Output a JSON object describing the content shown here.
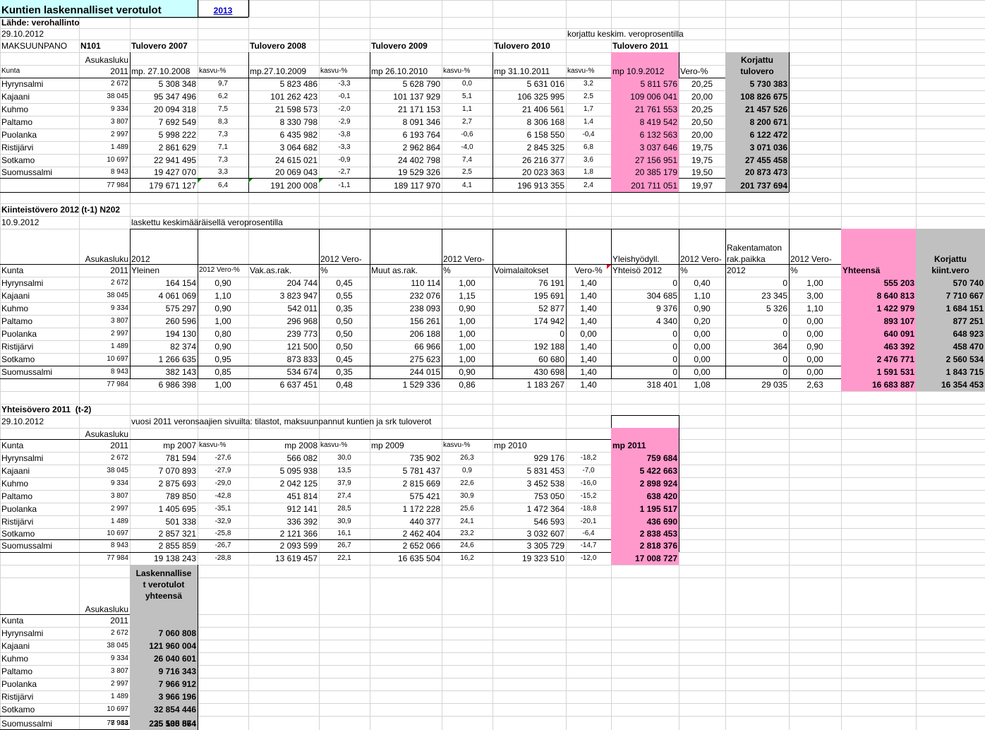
{
  "colors": {
    "pink": "#ff99cc",
    "gray": "#c0c0c0",
    "cyan": "#ccffff",
    "grid": "#d4d4d4",
    "link": "#0000cc"
  },
  "title": "Kuntien laskennalliset verotulot",
  "year_link": "2013",
  "source": "Lähde: verohallinto",
  "date1": "29.10.2012",
  "note1": "korjattu keskim. veroprosentilla",
  "maksuunpano": "MAKSUUNPANO",
  "n101": "N101",
  "income": {
    "year_heads": [
      "Tulovero 2007",
      "Tulovero 2008",
      "Tulovero 2009",
      "Tulovero 2010",
      "Tulovero 2011"
    ],
    "hdr": {
      "kunta": "Kunta",
      "asukas": "Asukasluku\n2011",
      "mp1": "mp. 27.10.2008",
      "k1": "kasvu-%",
      "mp2": "mp.27.10.2009",
      "k2": "kasvu-%",
      "mp3": "mp 26.10.2010",
      "k3": "kasvu-%",
      "mp4": "mp 31.10.2011",
      "k4": "kasvu-%",
      "mp5": "mp 10.9.2012",
      "vero": "Vero-%",
      "korj": "Korjattu\ntulovero"
    },
    "rows": [
      [
        "Hyrynsalmi",
        "2 672",
        "5 308 348",
        "9,7",
        "5 823 486",
        "-3,3",
        "5 628 790",
        "0,0",
        "5 631 016",
        "3,2",
        "5 811 576",
        "20,25",
        "5 730 383"
      ],
      [
        "Kajaani",
        "38 045",
        "95 347 496",
        "6,2",
        "101 262 423",
        "-0,1",
        "101 137 929",
        "5,1",
        "106 325 995",
        "2,5",
        "109 006 041",
        "20,00",
        "108 826 675"
      ],
      [
        "Kuhmo",
        "9 334",
        "20 094 318",
        "7,5",
        "21 598 573",
        "-2,0",
        "21 171 153",
        "1,1",
        "21 406 561",
        "1,7",
        "21 761 553",
        "20,25",
        "21 457 526"
      ],
      [
        "Paltamo",
        "3 807",
        "7 692 549",
        "8,3",
        "8 330 798",
        "-2,9",
        "8 091 346",
        "2,7",
        "8 306 168",
        "1,4",
        "8 419 542",
        "20,50",
        "8 200 671"
      ],
      [
        "Puolanka",
        "2 997",
        "5 998 222",
        "7,3",
        "6 435 982",
        "-3,8",
        "6 193 764",
        "-0,6",
        "6 158 550",
        "-0,4",
        "6 132 563",
        "20,00",
        "6 122 472"
      ],
      [
        "Ristijärvi",
        "1 489",
        "2 861 629",
        "7,1",
        "3 064 682",
        "-3,3",
        "2 962 864",
        "-4,0",
        "2 845 325",
        "6,8",
        "3 037 646",
        "19,75",
        "3 071 036"
      ],
      [
        "Sotkamo",
        "10 697",
        "22 941 495",
        "7,3",
        "24 615 021",
        "-0,9",
        "24 402 798",
        "7,4",
        "26 216 377",
        "3,6",
        "27 156 951",
        "19,75",
        "27 455 458"
      ],
      [
        "Suomussalmi",
        "8 943",
        "19 427 070",
        "3,3",
        "20 069 043",
        "-2,7",
        "19 529 326",
        "2,5",
        "20 023 363",
        "1,8",
        "20 385 179",
        "19,50",
        "20 873 473"
      ]
    ],
    "total": [
      "",
      "77 984",
      "179 671 127",
      "6,4",
      "191 200 008",
      "-1,1",
      "189 117 970",
      "4,1",
      "196 913 355",
      "2,4",
      "201 711 051",
      "19,97",
      "201 737 694"
    ]
  },
  "property": {
    "title": "Kiinteistövero 2012 (t-1) N202",
    "date": "10.9.2012",
    "note": "laskettu keskimääräisellä veroprosentilla",
    "hdr": {
      "kunta": "Kunta",
      "asukas": "Asukasluku\n2011",
      "yleinen": "2012\nYleinen",
      "v1": "2012 Vero-%",
      "vakas": "Vak.as.rak.",
      "v2": "2012 Vero-\n%",
      "muut": "Muut as.rak.",
      "v3": "2012 Vero-\n%",
      "voima": "Voimalaitokset",
      "v4": "Vero-%",
      "yleis": "Yleishyödyll.\nYhteisö 2012",
      "v5": "2012 Vero-\n%",
      "rak": "Rakentamaton\nrak.paikka\n2012",
      "v6": "2012 Vero-\n%",
      "yht": "Yhteensä",
      "korj": "Korjattu\nkiint.vero"
    },
    "rows": [
      [
        "Hyrynsalmi",
        "2 672",
        "164 154",
        "0,90",
        "204 744",
        "0,45",
        "110 114",
        "1,00",
        "76 191",
        "1,40",
        "0",
        "0,40",
        "0",
        "1,00",
        "555 203",
        "570 740"
      ],
      [
        "Kajaani",
        "38 045",
        "4 061 069",
        "1,10",
        "3 823 947",
        "0,55",
        "232 076",
        "1,15",
        "195 691",
        "1,40",
        "304 685",
        "1,10",
        "23 345",
        "3,00",
        "8 640 813",
        "7 710 667"
      ],
      [
        "Kuhmo",
        "9 334",
        "575 297",
        "0,90",
        "542 011",
        "0,35",
        "238 093",
        "0,90",
        "52 877",
        "1,40",
        "9 376",
        "0,90",
        "5 326",
        "1,10",
        "1 422 979",
        "1 684 151"
      ],
      [
        "Paltamo",
        "3 807",
        "260 596",
        "1,00",
        "296 968",
        "0,50",
        "156 261",
        "1,00",
        "174 942",
        "1,40",
        "4 340",
        "0,20",
        "0",
        "0,00",
        "893 107",
        "877 251"
      ],
      [
        "Puolanka",
        "2 997",
        "194 130",
        "0,80",
        "239 773",
        "0,50",
        "206 188",
        "1,00",
        "0",
        "0,00",
        "0",
        "0,00",
        "0",
        "0,00",
        "640 091",
        "648 923"
      ],
      [
        "Ristijärvi",
        "1 489",
        "82 374",
        "0,90",
        "121 500",
        "0,50",
        "66 966",
        "1,00",
        "192 188",
        "1,40",
        "0",
        "0,00",
        "364",
        "0,90",
        "463 392",
        "458 470"
      ],
      [
        "Sotkamo",
        "10 697",
        "1 266 635",
        "0,95",
        "873 833",
        "0,45",
        "275 623",
        "1,00",
        "60 680",
        "1,40",
        "0",
        "0,00",
        "0",
        "0,00",
        "2 476 771",
        "2 560 534"
      ],
      [
        "Suomussalmi",
        "8 943",
        "382 143",
        "0,85",
        "534 674",
        "0,35",
        "244 015",
        "0,90",
        "430 698",
        "1,40",
        "0",
        "0,00",
        "0",
        "0,00",
        "1 591 531",
        "1 843 715"
      ]
    ],
    "total": [
      "",
      "77 984",
      "6 986 398",
      "1,00",
      "6 637 451",
      "0,48",
      "1 529 336",
      "0,86",
      "1 183 267",
      "1,40",
      "318 401",
      "1,08",
      "29 035",
      "2,63",
      "16 683 887",
      "16 354 453"
    ]
  },
  "corporate": {
    "title": "Yhteisövero 2011  (t-2)",
    "date": "29.10.2012",
    "note": "vuosi 2011 veronsaajien sivuilta: tilastot, maksuunpannut kuntien ja srk tuloverot",
    "hdr": {
      "kunta": "Kunta",
      "asukas": "Asukasluku\n2011",
      "mp1": "mp 2007",
      "k1": "kasvu-%",
      "mp2": "mp 2008",
      "k2": "kasvu-%",
      "mp3": "mp 2009",
      "k3": "kasvu-%",
      "mp4": "mp 2010",
      "mp5": "mp 2011"
    },
    "rows": [
      [
        "Hyrynsalmi",
        "2 672",
        "781 594",
        "-27,6",
        "566 082",
        "30,0",
        "735 902",
        "26,3",
        "929 176",
        "-18,2",
        "759 684"
      ],
      [
        "Kajaani",
        "38 045",
        "7 070 893",
        "-27,9",
        "5 095 938",
        "13,5",
        "5 781 437",
        "0,9",
        "5 831 453",
        "-7,0",
        "5 422 663"
      ],
      [
        "Kuhmo",
        "9 334",
        "2 875 693",
        "-29,0",
        "2 042 125",
        "37,9",
        "2 815 669",
        "22,6",
        "3 452 538",
        "-16,0",
        "2 898 924"
      ],
      [
        "Paltamo",
        "3 807",
        "789 850",
        "-42,8",
        "451 814",
        "27,4",
        "575 421",
        "30,9",
        "753 050",
        "-15,2",
        "638 420"
      ],
      [
        "Puolanka",
        "2 997",
        "1 405 695",
        "-35,1",
        "912 141",
        "28,5",
        "1 172 228",
        "25,6",
        "1 472 364",
        "-18,8",
        "1 195 517"
      ],
      [
        "Ristijärvi",
        "1 489",
        "501 338",
        "-32,9",
        "336 392",
        "30,9",
        "440 377",
        "24,1",
        "546 593",
        "-20,1",
        "436 690"
      ],
      [
        "Sotkamo",
        "10 697",
        "2 857 321",
        "-25,8",
        "2 121 366",
        "16,1",
        "2 462 404",
        "23,2",
        "3 032 607",
        "-6,4",
        "2 838 453"
      ],
      [
        "Suomussalmi",
        "8 943",
        "2 855 859",
        "-26,7",
        "2 093 599",
        "26,7",
        "2 652 066",
        "24,6",
        "3 305 729",
        "-14,7",
        "2 818 376"
      ]
    ],
    "total": [
      "",
      "77 984",
      "19 138 243",
      "-28,8",
      "13 619 457",
      "22,1",
      "16 635 504",
      "16,2",
      "19 323 510",
      "-12,0",
      "17 008 727"
    ]
  },
  "summary": {
    "hdr": {
      "kunta": "Kunta",
      "asukas": "Asukasluku\n2011",
      "lask": "Laskennallise\nt verotulot\nyhteensä"
    },
    "rows": [
      [
        "Hyrynsalmi",
        "2 672",
        "7 060 808"
      ],
      [
        "Kajaani",
        "38 045",
        "121 960 004"
      ],
      [
        "Kuhmo",
        "9 334",
        "26 040 601"
      ],
      [
        "Paltamo",
        "3 807",
        "9 716 343"
      ],
      [
        "Puolanka",
        "2 997",
        "7 966 912"
      ],
      [
        "Ristijärvi",
        "1 489",
        "3 966 196"
      ],
      [
        "Sotkamo",
        "10 697",
        "32 854 446"
      ],
      [
        "Suomussalmi",
        "8 943",
        "25 535 564"
      ]
    ],
    "total": [
      "",
      "77 984",
      "235 100 874"
    ]
  }
}
